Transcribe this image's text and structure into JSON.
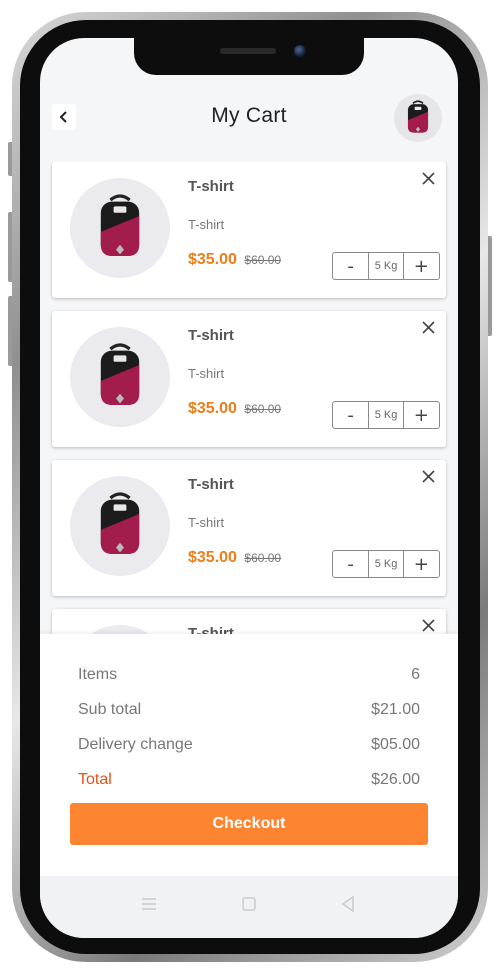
{
  "header": {
    "title": "My Cart"
  },
  "cart": {
    "items": [
      {
        "name": "T-shirt",
        "subtitle": "T-shirt",
        "price": "$35.00",
        "old_price": "$60.00",
        "minus": "-",
        "quantity": "5 Kg",
        "plus": "+"
      },
      {
        "name": "T-shirt",
        "subtitle": "T-shirt",
        "price": "$35.00",
        "old_price": "$60.00",
        "minus": "-",
        "quantity": "5 Kg",
        "plus": "+"
      },
      {
        "name": "T-shirt",
        "subtitle": "T-shirt",
        "price": "$35.00",
        "old_price": "$60.00",
        "minus": "-",
        "quantity": "5 Kg",
        "plus": "+"
      },
      {
        "name": "T-shirt"
      }
    ]
  },
  "summary": {
    "items_label": "Items",
    "items_value": "6",
    "subtotal_label": "Sub total",
    "subtotal_value": "$21.00",
    "delivery_label": "Delivery change",
    "delivery_value": "$05.00",
    "total_label": "Total",
    "total_value": "$26.00",
    "checkout_label": "Checkout"
  },
  "colors": {
    "accent": "#fd8431",
    "price": "#ee7d1a",
    "total_label": "#e0541a",
    "screen_bg": "#f5f6f8"
  },
  "icons": {
    "back": "chevron-left-icon",
    "remove": "close-icon",
    "nav": [
      "menu-icon",
      "square-icon",
      "triangle-back-icon"
    ]
  }
}
